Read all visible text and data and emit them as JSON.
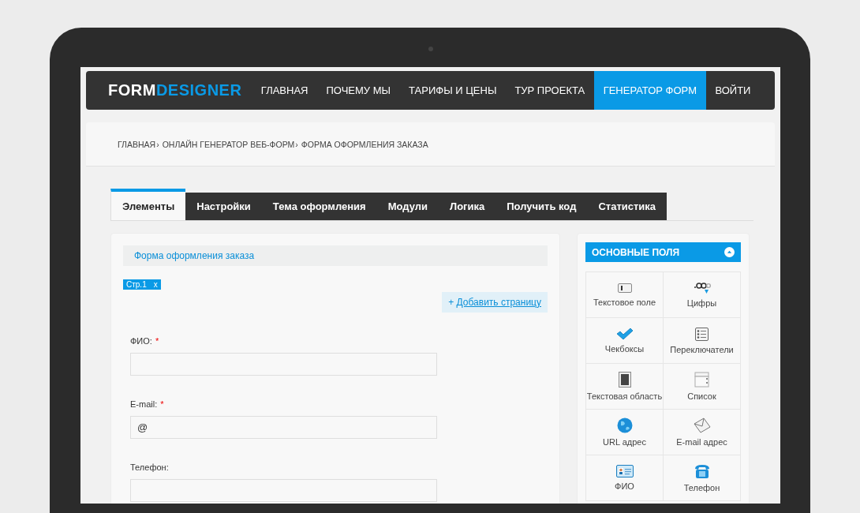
{
  "logo": {
    "text_1": "FORM",
    "text_2": "DESIGNER"
  },
  "nav": [
    {
      "label": "ГЛАВНАЯ",
      "selected": false
    },
    {
      "label": "ПОЧЕМУ МЫ",
      "selected": false
    },
    {
      "label": "ТАРИФЫ И ЦЕНЫ",
      "selected": false
    },
    {
      "label": "ТУР ПРОЕКТА",
      "selected": false
    },
    {
      "label": "ГЕНЕРАТОР ФОРМ",
      "selected": true
    },
    {
      "label": "ВОЙТИ",
      "selected": false
    }
  ],
  "breadcrumbs": [
    "ГЛАВНАЯ",
    "ОНЛАЙН ГЕНЕРАТОР ВЕБ-ФОРМ",
    "ФОРМА ОФОРМЛЕНИЯ ЗАКАЗА"
  ],
  "breadcrumb_separator": "›",
  "tabs": [
    {
      "label": "Элементы",
      "selected": true
    },
    {
      "label": "Настройки",
      "selected": false
    },
    {
      "label": "Тема оформления",
      "selected": false
    },
    {
      "label": "Модули",
      "selected": false
    },
    {
      "label": "Логика",
      "selected": false
    },
    {
      "label": "Получить код",
      "selected": false
    },
    {
      "label": "Статистика",
      "selected": false
    }
  ],
  "form": {
    "title": "Форма оформления заказа",
    "page_chip": {
      "label": "Стр.1",
      "close": "x"
    },
    "add_page": {
      "plus": "+",
      "label": "Добавить страницу"
    },
    "fields": [
      {
        "label": "ФИО:",
        "required": true
      },
      {
        "label": "E-mail:",
        "required": true,
        "value": "@"
      },
      {
        "label": "Телефон:",
        "required": false
      }
    ],
    "required_mark": "*"
  },
  "palette": {
    "title": "ОСНОВНЫЕ ПОЛЯ",
    "expanded": true,
    "items": [
      "Текстовое поле",
      "Цифры",
      "Чекбоксы",
      "Переключатели",
      "Текстовая область",
      "Список",
      "URL адрес",
      "E-mail адрес",
      "ФИО",
      "Телефон"
    ]
  }
}
